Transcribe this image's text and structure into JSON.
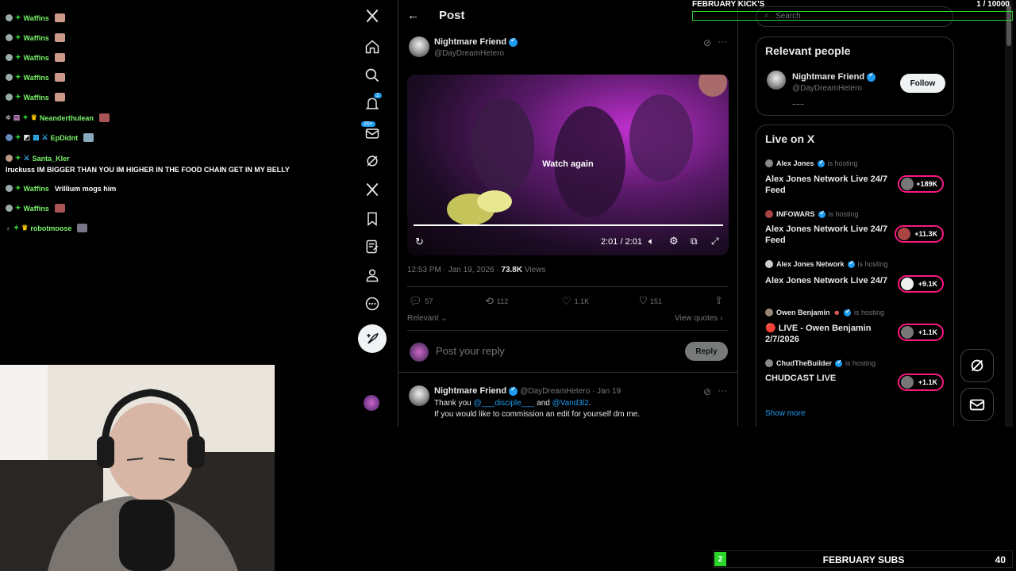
{
  "chat": {
    "lines": [
      {
        "user": "Waffins",
        "message": ""
      },
      {
        "user": "Waffins",
        "message": ""
      },
      {
        "user": "Waffins",
        "message": ""
      },
      {
        "user": "Waffins",
        "message": ""
      },
      {
        "user": "Waffins",
        "message": ""
      },
      {
        "user": "Neanderthulean",
        "message": ""
      },
      {
        "user": "EpDidnt",
        "message": ""
      },
      {
        "user": "Santa_Kler",
        "message": "Iruckuss IM BIGGER THAN YOU IM HIGHER IN THE FOOD CHAIN GET IN MY BELLY"
      },
      {
        "user": "Waffins",
        "message": "Vrillium mogs him"
      },
      {
        "user": "Waffins",
        "message": ""
      },
      {
        "user": "robotmoose",
        "message": ""
      }
    ]
  },
  "nav": {
    "notification_badge": "2",
    "messages_badge": "20+"
  },
  "post_header": {
    "title": "Post"
  },
  "post": {
    "author_name": "Nightmare Friend",
    "author_handle": "@DayDreamHetero",
    "video_overlay": "Watch again",
    "video_time": "2:01 / 2:01",
    "video_progress": 1.0,
    "timestamp": "12:53 PM · Jan 19, 2026 ·",
    "views_count": "73.8K",
    "views_label": "Views",
    "replies": "57",
    "reposts": "112",
    "likes": "1.1K",
    "bookmarks": "151",
    "sort_label": "Relevant",
    "view_quotes": "View quotes",
    "reply_placeholder": "Post your reply",
    "reply_button": "Reply"
  },
  "reply": {
    "author_name": "Nightmare Friend",
    "author_handle": "@DayDreamHetero · Jan 19",
    "text_prefix": "Thank you",
    "mention1": "@___disciple___",
    "text_mid": "and",
    "mention2": "@Vand3l2",
    "text_end": ".",
    "line2": "If you would like to commission an edit for yourself dm me."
  },
  "search": {
    "placeholder": "Search"
  },
  "relevant_people": {
    "title": "Relevant people",
    "name": "Nightmare Friend",
    "handle": "@DayDreamHetero",
    "bio": "......",
    "follow_label": "Follow"
  },
  "live": {
    "title": "Live on X",
    "items": [
      {
        "host": "Alex Jones",
        "status": "is hosting",
        "title": "Alex Jones Network Live 24/7 Feed",
        "count": "+189K"
      },
      {
        "host": "INFOWARS",
        "status": "is hosting",
        "title": "Alex Jones Network Live 24/7 Feed",
        "count": "+11.3K"
      },
      {
        "host": "Alex Jones Network",
        "status": "is hosting",
        "title": "Alex Jones Network Live 24/7",
        "count": "+9.1K"
      },
      {
        "host": "Owen Benjamin",
        "status": "is hosting",
        "title": "🔴 LIVE - Owen Benjamin 2/7/2026",
        "count": "+1.1K"
      },
      {
        "host": "ChudTheBuilder",
        "status": "is hosting",
        "title": "CHUDCAST LIVE",
        "count": "+1.1K"
      }
    ],
    "show_more": "Show more"
  },
  "overlay": {
    "kicks_label": "FEBRUARY KICK'S",
    "kicks_count": "1 / 10000",
    "subs_badge": "2",
    "subs_label": "FEBRUARY SUBS",
    "subs_count": "40"
  },
  "colors": {
    "accent": "#1d9bf0",
    "live": "#f91880",
    "chat_user": "#7cf36c",
    "overlay_green": "#2bd62b"
  }
}
